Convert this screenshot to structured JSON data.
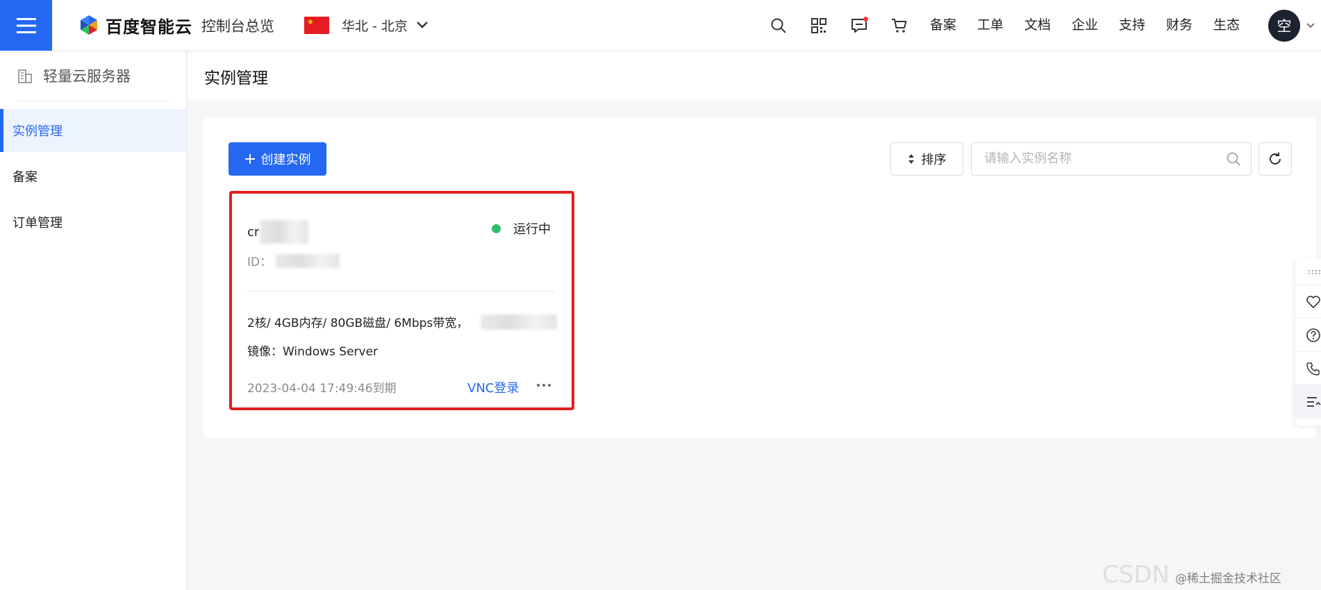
{
  "header": {
    "brand": "百度智能云",
    "console_link": "控制台总览",
    "region": "华北 - 北京",
    "nav_links": [
      "备案",
      "工单",
      "文档",
      "企业",
      "支持",
      "财务",
      "生态"
    ],
    "avatar_text": "空",
    "icons": [
      "search-icon",
      "qrcode-icon",
      "message-icon",
      "cart-icon"
    ]
  },
  "sidebar": {
    "title": "轻量云服务器",
    "items": [
      {
        "label": "实例管理",
        "active": true
      },
      {
        "label": "备案",
        "active": false
      },
      {
        "label": "订单管理",
        "active": false
      }
    ]
  },
  "main": {
    "page_title": "实例管理",
    "create_button": "创建实例",
    "sort_button": "排序",
    "search_placeholder": "请输入实例名称"
  },
  "instance": {
    "name_prefix": "cr",
    "status": "运行中",
    "id_label": "ID：",
    "spec": "2核/ 4GB内存/ 80GB磁盘/ 6Mbps带宽，",
    "image": "镜像：Windows Server",
    "expire": "2023-04-04 17:49:46到期",
    "vnc_link": "VNC登录",
    "more": "···"
  },
  "float_toolbar": [
    "grip-icon",
    "heart-icon",
    "help-icon",
    "phone-icon",
    "list-icon"
  ],
  "watermark": {
    "main": "CSDN",
    "sub": "@稀土掘金技术社区"
  },
  "colors": {
    "brand_blue": "#2468f2",
    "status_green": "#30bf6b",
    "highlight_red": "#e02020"
  }
}
